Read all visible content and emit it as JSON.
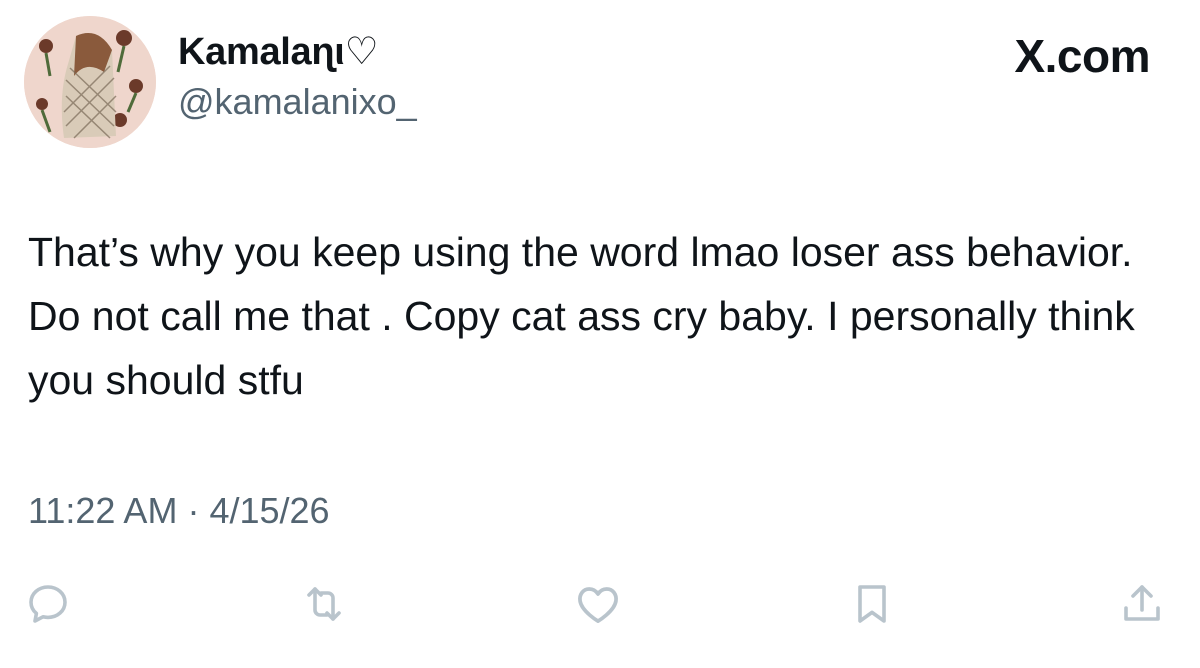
{
  "author": {
    "display_name": "Kamalaɳι",
    "name_symbol": "♡",
    "handle": "@kamalanixo_"
  },
  "brand": "X.com",
  "tweet": {
    "text": "That’s why you keep using the word lmao loser ass behavior. Do not call me that . Copy cat ass cry baby. I personally think you should stfu",
    "time": "11:22 AM",
    "separator": "·",
    "date": "4/15/26"
  },
  "actions": [
    {
      "name": "reply",
      "icon": "reply-icon"
    },
    {
      "name": "repost",
      "icon": "repost-icon"
    },
    {
      "name": "like",
      "icon": "heart-icon"
    },
    {
      "name": "bookmark",
      "icon": "bookmark-icon"
    },
    {
      "name": "share",
      "icon": "share-icon"
    }
  ],
  "colors": {
    "text": "#0f1419",
    "secondary": "#536471",
    "icon": "#b9c4cc",
    "background": "#ffffff"
  }
}
